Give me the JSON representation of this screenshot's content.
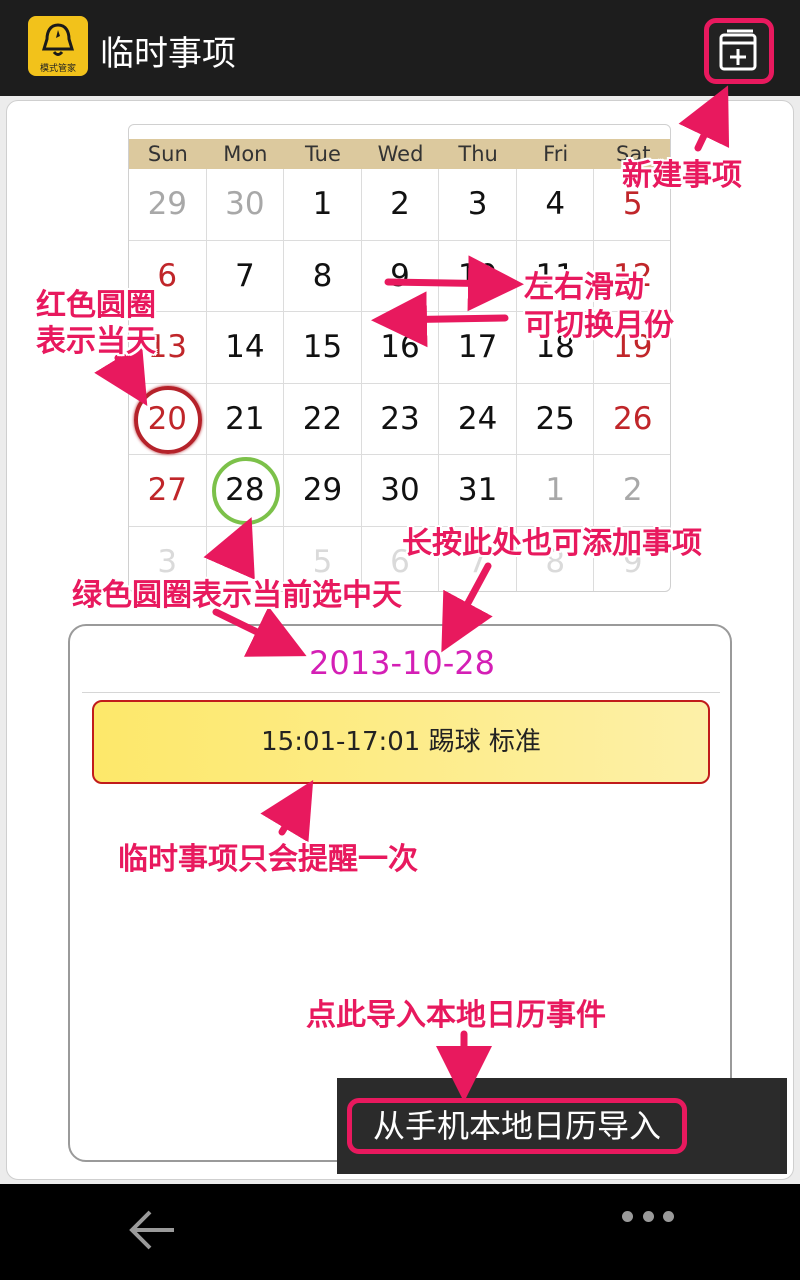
{
  "header": {
    "title": "临时事项",
    "app_icon_caption": "模式管家",
    "new_button_icon": "add-event-icon"
  },
  "calendar": {
    "weekdays": [
      "Sun",
      "Mon",
      "Tue",
      "Wed",
      "Thu",
      "Fri",
      "Sat"
    ],
    "weeks": [
      [
        "29",
        "30",
        "1",
        "2",
        "3",
        "4",
        "5"
      ],
      [
        "6",
        "7",
        "8",
        "9",
        "10",
        "11",
        "12"
      ],
      [
        "13",
        "14",
        "15",
        "16",
        "17",
        "18",
        "19"
      ],
      [
        "20",
        "21",
        "22",
        "23",
        "24",
        "25",
        "26"
      ],
      [
        "27",
        "28",
        "29",
        "30",
        "31",
        "1",
        "2"
      ],
      [
        "3",
        "4",
        "5",
        "6",
        "7",
        "8",
        "9"
      ]
    ],
    "today": "20",
    "selected": "28",
    "today_color": "#b5222a",
    "selected_color": "#7cc14a"
  },
  "events": {
    "date": "2013-10-28",
    "items": [
      {
        "text": "15:01-17:01  踢球  标准"
      }
    ],
    "import_label": "从手机本地日历导入"
  },
  "annotations": {
    "new_item": "新建事项",
    "red_circle_line1": "红色圆圈",
    "red_circle_line2": "表示当天",
    "swipe_line1": "左右滑动",
    "swipe_line2": "可切换月份",
    "long_press": "长按此处也可添加事项",
    "green_circle": "绿色圆圈表示当前选中天",
    "once_only": "临时事项只会提醒一次",
    "import_hint": "点此导入本地日历事件",
    "color": "#e8195e"
  },
  "navbar": {
    "back_icon": "back-arrow-icon",
    "menu_icon": "more-dots-icon"
  }
}
